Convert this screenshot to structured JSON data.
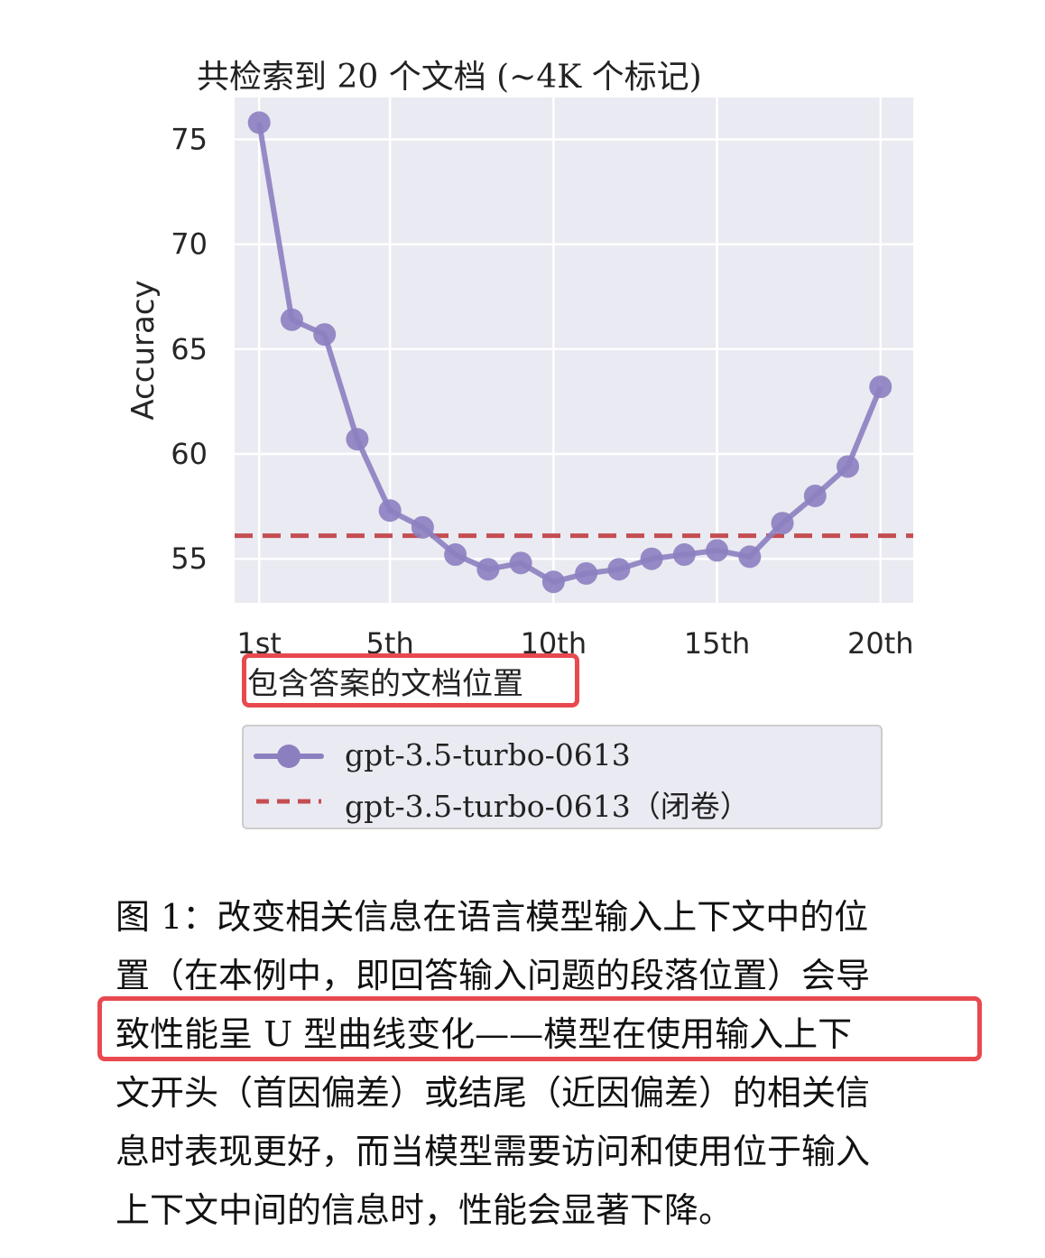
{
  "chart_data": {
    "type": "line",
    "title": "共检索到 20 个文档 (~4K 个标记)",
    "xlabel": "包含答案的文档位置",
    "ylabel": "Accuracy",
    "x": [
      1,
      2,
      3,
      4,
      5,
      6,
      7,
      8,
      9,
      10,
      11,
      12,
      13,
      14,
      15,
      16,
      17,
      18,
      19,
      20
    ],
    "x_ticks": [
      1,
      5,
      10,
      15,
      20
    ],
    "x_tick_labels": [
      "1st",
      "5th",
      "10th",
      "15th",
      "20th"
    ],
    "xlim": [
      0.25,
      21
    ],
    "y_ticks": [
      55,
      60,
      65,
      70,
      75
    ],
    "ylim": [
      52.9,
      77.0
    ],
    "grid": true,
    "series": [
      {
        "name": "gpt-3.5-turbo-0613",
        "style": "line-with-markers",
        "color": "#8c7fc0",
        "values": [
          75.8,
          66.4,
          65.7,
          60.7,
          57.3,
          56.5,
          55.2,
          54.5,
          54.8,
          53.9,
          54.3,
          54.5,
          55.0,
          55.2,
          55.4,
          55.1,
          56.7,
          58.0,
          59.4,
          63.2
        ]
      },
      {
        "name": "gpt-3.5-turbo-0613（闭卷）",
        "style": "dashed-horizontal",
        "color": "#c44e52",
        "value": 56.1
      }
    ],
    "legend": "bottom, below the x-axis label"
  },
  "caption": {
    "lines": [
      "图 1：改变相关信息在语言模型输入上下文中的位",
      "置（在本例中，即回答输入问题的段落位置）会导",
      "致性能呈 U 型曲线变化——模型在使用输入上下",
      "文开头（首因偏差）或结尾（近因偏差）的相关信",
      "息时表现更好，而当模型需要访问和使用位于输入",
      "上下文中间的信息时，性能会显著下降。"
    ]
  },
  "highlight_color": "#e8494f",
  "plot_background": "#eaeaf2"
}
